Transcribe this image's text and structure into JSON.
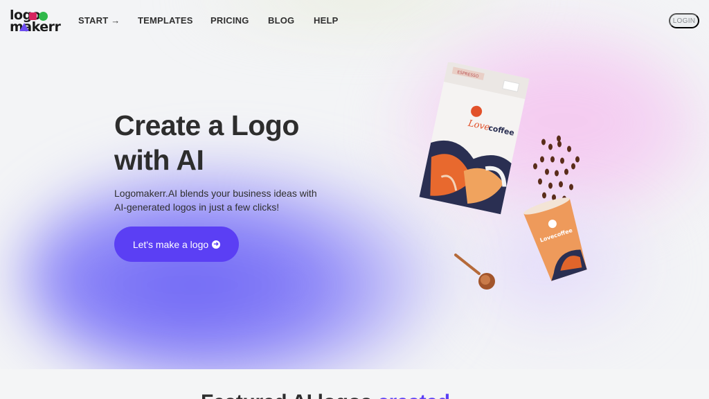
{
  "brand": {
    "line1": "logo",
    "line2": "makerr",
    "green": "#2fb84a",
    "pink": "#d6245f",
    "purple": "#6c4cf0"
  },
  "nav": {
    "items": [
      {
        "label": "START",
        "icon": "arrow-right-icon"
      },
      {
        "label": "TEMPLATES"
      },
      {
        "label": "PRICING"
      },
      {
        "label": "BLOG"
      },
      {
        "label": "HELP"
      }
    ],
    "login_label": "LOGIN"
  },
  "hero": {
    "title_line1": "Create a Logo",
    "title_line2": "with AI",
    "subtitle_line1": "Logomakerr.AI blends your business ideas with",
    "subtitle_line2": "AI-generated logos in just a few clicks!",
    "cta_label": "Let's make a logo",
    "cta_icon": "arrow-circle-right-icon",
    "accent": "#5b3ff4"
  },
  "illustration": {
    "bag_top_label": "ESPRESSO",
    "bag_brand_small": "Love",
    "bag_brand_large": "coffee",
    "cup_brand": "Lovecoffee"
  },
  "section": {
    "heading_start": "Featured AI logos",
    "heading_accent": "created"
  }
}
